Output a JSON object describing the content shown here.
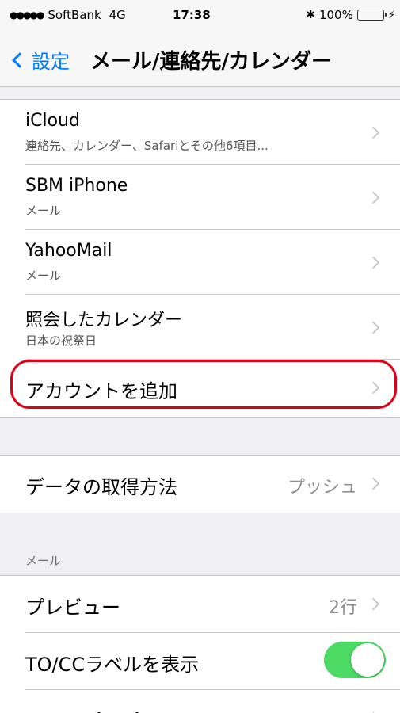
{
  "status_bar": {
    "carrier": "SoftBank",
    "network": "4G",
    "time": "17:38",
    "battery": "100%",
    "battery_level": 1.0
  },
  "nav": {
    "back_label": "設定",
    "title": "メール/連絡先/カレンダー"
  },
  "accounts": [
    {
      "title": "iCloud",
      "subtitle": "連絡先、カレンダー、Safariとその他6項目..."
    },
    {
      "title": "SBM iPhone",
      "subtitle": "メール"
    },
    {
      "title": "YahooMail",
      "subtitle": "メール"
    },
    {
      "title": "照会したカレンダー",
      "subtitle": "日本の祝祭日"
    }
  ],
  "add_account": {
    "label": "アカウントを追加"
  },
  "fetch": {
    "label": "データの取得方法",
    "value": "プッシュ"
  },
  "mail_section": {
    "header": "メール",
    "preview": {
      "label": "プレビュー",
      "value": "2行"
    },
    "show_to_cc": {
      "label": "TO/CCラベルを表示",
      "enabled": true
    },
    "swipe_options": {
      "label": "スワイプオプション"
    }
  }
}
